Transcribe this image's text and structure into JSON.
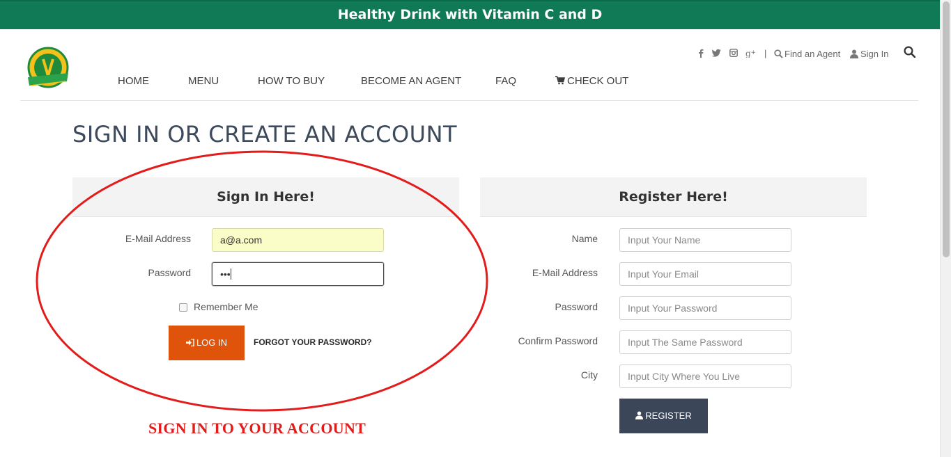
{
  "banner": {
    "text": "Healthy Drink with Vitamin C and D",
    "bg_color": "#0f7a55"
  },
  "logo": {
    "name": "brand-logo"
  },
  "nav": {
    "home": "HOME",
    "menu": "MENU",
    "how_to_buy": "HOW TO BUY",
    "become_agent": "BECOME AN AGENT",
    "faq": "FAQ",
    "checkout": "CHECK OUT"
  },
  "utility": {
    "social_icons": [
      "facebook-icon",
      "twitter-icon",
      "instagram-icon",
      "google-plus-icon"
    ],
    "separator": "|",
    "find_agent": "Find an Agent",
    "sign_in": "Sign In"
  },
  "page": {
    "title": "SIGN IN OR CREATE AN ACCOUNT"
  },
  "signin": {
    "heading": "Sign In Here!",
    "email_label": "E-Mail Address",
    "email_value": "a@a.com",
    "password_label": "Password",
    "password_value": "•••",
    "remember_label": "Remember Me",
    "login_label": "LOG IN",
    "forgot_label": "FORGOT YOUR PASSWORD?",
    "button_color": "#e0530b"
  },
  "register": {
    "heading": "Register Here!",
    "name_label": "Name",
    "name_placeholder": "Input Your Name",
    "email_label": "E-Mail Address",
    "email_placeholder": "Input Your Email",
    "password_label": "Password",
    "password_placeholder": "Input Your Password",
    "confirm_label": "Confirm Password",
    "confirm_placeholder": "Input The Same Password",
    "city_label": "City",
    "city_placeholder": "Input City Where You Live",
    "register_label": "REGISTER",
    "button_color": "#3b4759"
  },
  "annotation": {
    "text": "SIGN IN TO YOUR ACCOUNT",
    "color": "#e21b1b"
  }
}
